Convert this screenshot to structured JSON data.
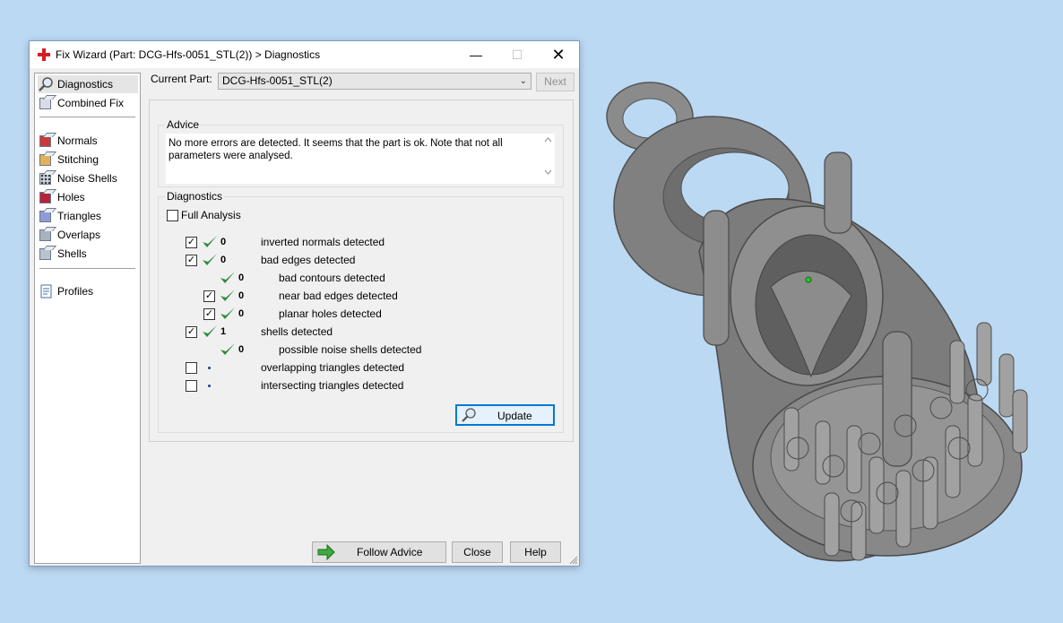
{
  "window": {
    "title": "Fix Wizard (Part: DCG-Hfs-0051_STL(2)) > Diagnostics",
    "minimize_glyph": "—",
    "maximize_glyph": "☐",
    "close_glyph": "✕"
  },
  "sidebar": {
    "items": [
      {
        "label": "Diagnostics",
        "icon": "magnifier-icon",
        "selected": true
      },
      {
        "label": "Combined Fix",
        "icon": "combined-fix-icon"
      },
      {
        "label": "Normals",
        "icon": "normals-icon"
      },
      {
        "label": "Stitching",
        "icon": "stitching-icon"
      },
      {
        "label": "Noise Shells",
        "icon": "noise-shells-icon"
      },
      {
        "label": "Holes",
        "icon": "holes-icon"
      },
      {
        "label": "Triangles",
        "icon": "triangles-icon"
      },
      {
        "label": "Overlaps",
        "icon": "overlaps-icon"
      },
      {
        "label": "Shells",
        "icon": "shells-icon"
      },
      {
        "label": "Profiles",
        "icon": "profiles-icon"
      }
    ]
  },
  "current_part": {
    "label": "Current Part:",
    "value": "DCG-Hfs-0051_STL(2)",
    "next_label": "Next"
  },
  "advice": {
    "legend": "Advice",
    "text": "No more errors are detected. It seems that the part is ok. Note that not all parameters were analysed."
  },
  "diagnostics": {
    "legend": "Diagnostics",
    "full_analysis_label": "Full Analysis",
    "full_analysis_checked": false,
    "rows": [
      {
        "checked": true,
        "status": "ok",
        "count": "0",
        "label": "inverted normals detected"
      },
      {
        "checked": true,
        "status": "ok",
        "count": "0",
        "label": "bad edges detected"
      },
      {
        "checked": null,
        "status": "ok",
        "count": "0",
        "label": "bad contours detected"
      },
      {
        "checked": true,
        "status": "ok",
        "count": "0",
        "label": "near bad edges detected"
      },
      {
        "checked": true,
        "status": "ok",
        "count": "0",
        "label": "planar holes detected"
      },
      {
        "checked": true,
        "status": "ok",
        "count": "1",
        "label": "shells detected"
      },
      {
        "checked": null,
        "status": "ok",
        "count": "0",
        "label": "possible noise shells detected"
      },
      {
        "checked": false,
        "status": "pending",
        "count": "",
        "label": "overlapping triangles detected"
      },
      {
        "checked": false,
        "status": "pending",
        "count": "",
        "label": "intersecting triangles detected"
      }
    ],
    "update_label": "Update"
  },
  "footer": {
    "follow_advice_label": "Follow Advice",
    "close_label": "Close",
    "help_label": "Help"
  },
  "colors": {
    "background": "#bcd9f3",
    "check_green": "#2e8b3a",
    "accent_blue": "#0078d7",
    "model_gray": "#8a8a8a"
  }
}
